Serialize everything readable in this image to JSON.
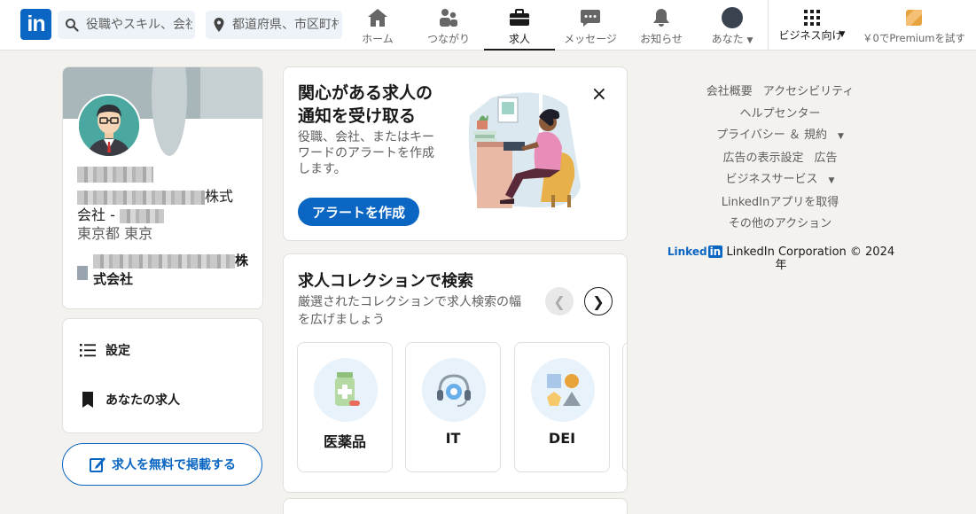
{
  "nav": {
    "logo": "in",
    "search_placeholder": "役職やスキル、会社",
    "location_placeholder": "都道府県、市区町村",
    "items": [
      {
        "label": "ホーム"
      },
      {
        "label": "つながり"
      },
      {
        "label": "求人"
      },
      {
        "label": "メッセージ"
      },
      {
        "label": "お知らせ"
      },
      {
        "label": "あなた"
      }
    ],
    "business_label": "ビジネス向け",
    "premium_label": "￥0でPremiumを試す"
  },
  "profile": {
    "company_suffix": "株式",
    "company_line2": "会社 - ",
    "location": "東京都 東京",
    "org_suffix": "株",
    "org_line2": "式会社"
  },
  "sidebar_menu": {
    "settings_label": "設定",
    "my_jobs_label": "あなたの求人"
  },
  "post_job_label": "求人を無料で掲載する",
  "alert_card": {
    "title_line1": "関心がある求人の",
    "title_line2": "通知を受け取る",
    "desc_line1": "役職、会社、またはキー",
    "desc_line2": "ワードのアラートを作成",
    "desc_line3": "します。",
    "button": "アラートを作成",
    "close": "×"
  },
  "collections": {
    "title": "求人コレクションで検索",
    "desc_line1": "厳選されたコレクションで求人検索の幅",
    "desc_line2": "を広げましょう",
    "prev": "❮",
    "next": "❯",
    "items": [
      {
        "label": "医薬品",
        "icon": "medicine-bottle-icon"
      },
      {
        "label": "IT",
        "icon": "headset-gear-icon"
      },
      {
        "label": "DEI",
        "icon": "shapes-icon"
      }
    ]
  },
  "footer": {
    "about": "会社概要",
    "accessibility": "アクセシビリティ",
    "help": "ヘルプセンター",
    "privacy": "プライバシー ＆ 規約",
    "ad_settings": "広告の表示設定",
    "ads": "広告",
    "business_services": "ビジネスサービス",
    "get_app": "LinkedInアプリを取得",
    "more": "その他のアクション",
    "brand": "Linked",
    "brand_in": "in",
    "copyright_line1": "LinkedIn Corporation © 2024",
    "copyright_line2": "年"
  },
  "colors": {
    "brand": "#0a66c2",
    "background": "#f4f2ee"
  }
}
